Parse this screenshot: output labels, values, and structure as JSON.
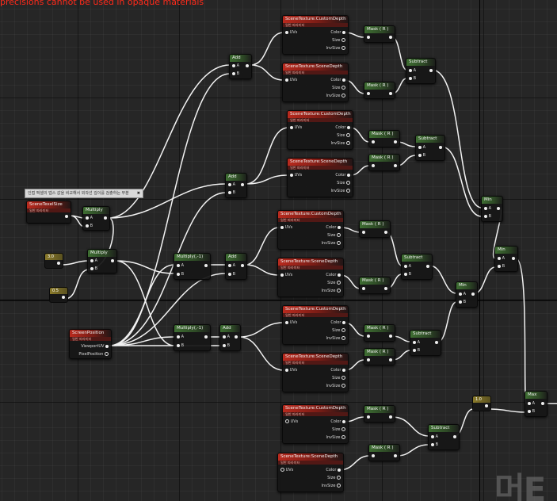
{
  "top_message": "precisions cannot be used in opaque materials",
  "comment": {
    "text": "인접 픽셀의 뎁스 값을 비교해서 외곽선 깊이를 검출하는 부분",
    "close": "✖"
  },
  "labels": {
    "scene_texture_custom_depth": "SceneTexture:CustomDepth",
    "scene_texture_scene_depth": "SceneTexture:SceneDepth",
    "subtitle_param": "일반 파라미터",
    "uvs": "UVs",
    "color": "Color",
    "size": "Size",
    "inv_size": "InvSize",
    "mask_r": "Mask ( R )",
    "subtract": "Subtract",
    "add": "Add",
    "min": "Min",
    "max": "Max",
    "multiply": "Multiply",
    "multiply_neg1": "Multiply(,-1)",
    "pin_a": "A",
    "pin_b": "B",
    "scene_texel_size": "SceneTexelSize",
    "screen_position": "ScreenPosition",
    "viewport_uv": "ViewportUV",
    "pixel_position": "PixelPosition",
    "const_3": "3.0",
    "const_05": "0.5",
    "const_1": "1.0"
  },
  "watermark": "머E"
}
